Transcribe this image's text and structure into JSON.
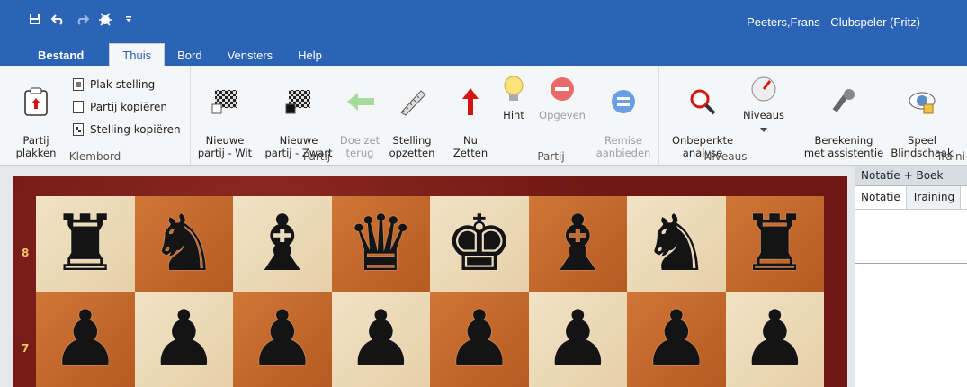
{
  "window": {
    "title": "Peeters,Frans - Clubspeler (Fritz)",
    "qat_icons": [
      "save-icon",
      "undo-icon",
      "redo-icon",
      "engine-icon",
      "customize-icon"
    ]
  },
  "menu": {
    "tabs": [
      "Bestand",
      "Thuis",
      "Bord",
      "Vensters",
      "Help"
    ],
    "active": "Thuis"
  },
  "ribbon": {
    "klembord": {
      "label": "Klembord",
      "paste_game": "Partij\nplakken",
      "paste_position": "Plak stelling",
      "copy_game": "Partij kopiëren",
      "copy_position": "Stelling kopiëren"
    },
    "partij1": {
      "label": "Partij",
      "new_white": "Nieuwe\npartij - Wit",
      "new_black": "Nieuwe\npartij - Zwart",
      "take_back": "Doe zet\nterug",
      "setup": "Stelling\nopzetten"
    },
    "partij2": {
      "label": "Partij",
      "move_now": "Nu\nZetten",
      "hint": "Hint",
      "resign": "Opgeven",
      "offer_draw": "Remise\naanbieden"
    },
    "niveaus": {
      "label": "Niveaus",
      "unlimited": "Onbeperkte\nanalyse",
      "levels": "Niveaus"
    },
    "training": {
      "label": "Traini",
      "assisted": "Berekening\nmet assistentie",
      "blind": "Speel\nBlindschaak"
    }
  },
  "board": {
    "ranks": [
      "8",
      "7"
    ],
    "rank8": [
      "♜",
      "♞",
      "♝",
      "♛",
      "♚",
      "♝",
      "♞",
      "♜"
    ],
    "rank7": [
      "♟",
      "♟",
      "♟",
      "♟",
      "♟",
      "♟",
      "♟",
      "♟"
    ]
  },
  "pane": {
    "title": "Notatie + Boek",
    "tabs": [
      "Notatie",
      "Training"
    ]
  },
  "colors": {
    "titlebar": "#2b63b7",
    "ribbon": "#f5f6f7",
    "frame": "#7a1f1a",
    "light_square": "#ecd9b6",
    "dark_square": "#c7692d"
  }
}
